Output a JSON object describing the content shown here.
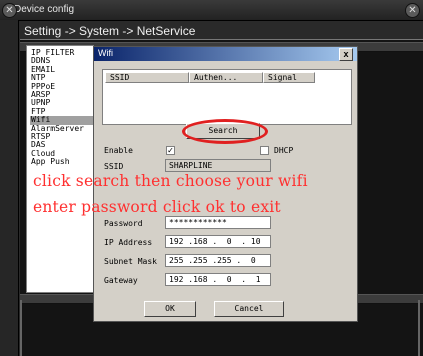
{
  "window": {
    "title": "Device config",
    "close_glyph": "✕",
    "close_icon": "close-icon"
  },
  "breadcrumb": "Setting -> System -> NetService",
  "service_list": {
    "items": [
      "IP FILTER",
      "DDNS",
      "EMAIL",
      "NTP",
      "PPPoE",
      "ARSP",
      "UPNP",
      "FTP",
      "Wifi",
      "AlarmServer",
      "RTSP",
      "DAS",
      "Cloud",
      "App Push"
    ],
    "selected": "Wifi"
  },
  "wifi_dialog": {
    "title": "Wifi",
    "close_glyph": "x",
    "columns": [
      "SSID",
      "Authen...",
      "Signal"
    ],
    "rows": [],
    "search_label": "Search",
    "enable_label": "Enable",
    "enable_checked": true,
    "check_glyph": "✓",
    "dhcp_label": "DHCP",
    "dhcp_checked": false,
    "ssid_label": "SSID",
    "ssid_value": "SHARPLINE",
    "password_label": "Password",
    "password_value": "************",
    "ip_label": "IP Address",
    "ip_value": "192 .168 .  0  . 10",
    "mask_label": "Subnet Mask",
    "mask_value": "255 .255 .255 .  0",
    "gateway_label": "Gateway",
    "gateway_value": "192 .168 .  0  .  1",
    "ok_label": "OK",
    "cancel_label": "Cancel"
  },
  "overlay": {
    "line1": "click search then choose your wifi",
    "line2": "enter password click ok to exit",
    "color": "#ff3030",
    "highlight_color": "#e02020"
  }
}
